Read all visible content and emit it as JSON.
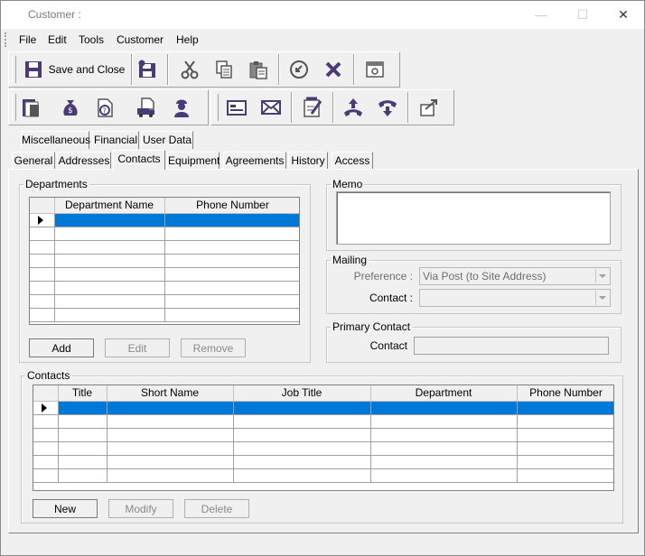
{
  "window": {
    "title": "Customer :",
    "minimize": "—",
    "maximize": "☐",
    "close": "✕"
  },
  "menu": [
    "File",
    "Edit",
    "Tools",
    "Customer",
    "Help"
  ],
  "toolbar1": {
    "save_close_label": "Save and Close",
    "buttons": [
      "save-icon",
      "save-new-icon",
      "cut-icon",
      "copy-icon",
      "paste-icon",
      "undo-icon",
      "delete-icon",
      "view-icon"
    ]
  },
  "toolbar2": {
    "buttons": [
      "book-icon",
      "money-bag-icon",
      "help-document-icon",
      "document-truck-icon",
      "technician-icon",
      "card-icon",
      "envelope-icon",
      "notepad-icon",
      "phone-incoming-icon",
      "phone-outgoing-icon",
      "transfer-icon"
    ]
  },
  "tabs_row1": [
    "Miscellaneous",
    "Financial",
    "User Data"
  ],
  "tabs_row2": [
    "General",
    "Addresses",
    "Contacts",
    "Equipment",
    "Agreements",
    "History",
    "Access"
  ],
  "active_tab": "Contacts",
  "departments": {
    "title": "Departments",
    "columns": [
      "Department Name",
      "Phone Number"
    ],
    "buttons": {
      "add": "Add",
      "edit": "Edit",
      "remove": "Remove"
    }
  },
  "memo": {
    "title": "Memo",
    "value": ""
  },
  "mailing": {
    "title": "Mailing",
    "preference_label": "Preference :",
    "preference_value": "Via Post (to Site Address)",
    "contact_label": "Contact :",
    "contact_value": ""
  },
  "primary_contact": {
    "title": "Primary Contact",
    "contact_label": "Contact",
    "contact_value": ""
  },
  "contacts": {
    "title": "Contacts",
    "columns": [
      "Title",
      "Short Name",
      "Job Title",
      "Department",
      "Phone Number"
    ],
    "buttons": {
      "new": "New",
      "modify": "Modify",
      "delete": "Delete"
    }
  },
  "colors": {
    "selection": "#0078d7",
    "icon": "#4b3a78"
  }
}
